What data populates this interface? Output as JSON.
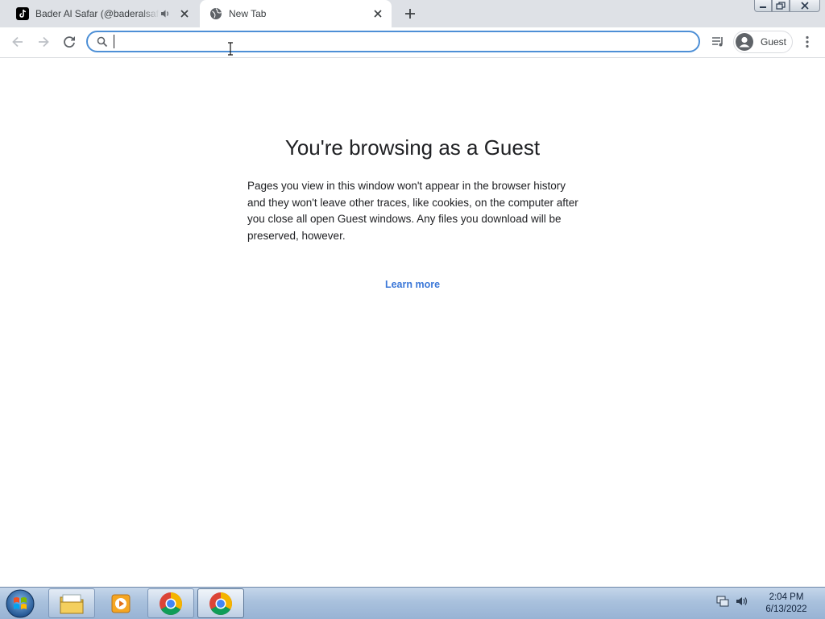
{
  "tabs": [
    {
      "title": "Bader Al Safar (@baderalsafar",
      "icon": "tiktok-icon",
      "audio": true,
      "active": false
    },
    {
      "title": "New Tab",
      "icon": "globe-icon",
      "audio": false,
      "active": true
    }
  ],
  "omnibox": {
    "value": "",
    "placeholder": ""
  },
  "profile": {
    "label": "Guest"
  },
  "content": {
    "title": "You're browsing as a Guest",
    "description": "Pages you view in this window won't appear in the browser history and they won't leave other traces, like cookies, on the computer after you close all open Guest windows. Any files you download will be preserved, however.",
    "learn_more": "Learn more"
  },
  "taskbar": {
    "items": [
      "file-explorer-icon",
      "media-player-icon",
      "chrome-icon",
      "chrome-icon"
    ],
    "clock_time": "2:04 PM",
    "clock_date": "6/13/2022"
  },
  "colors": {
    "accent": "#3c78d8",
    "omnibox_focus": "#4d8fd6",
    "tabstrip": "#dee1e6"
  }
}
